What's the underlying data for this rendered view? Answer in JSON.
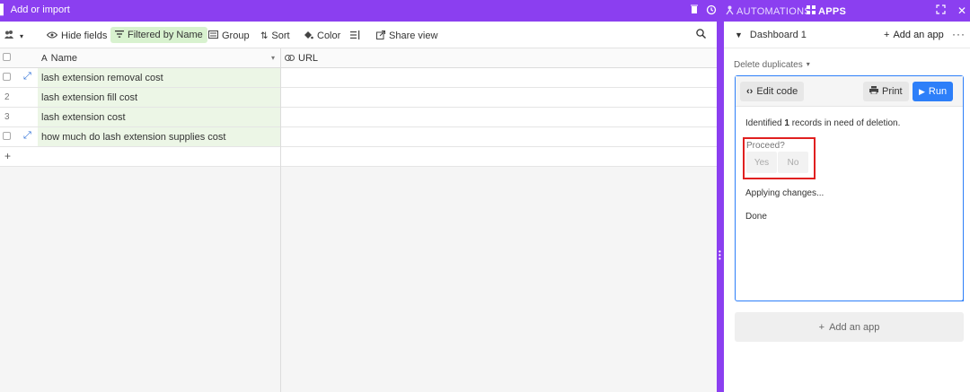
{
  "topbar": {
    "add_import": "Add or import",
    "automations": "AUTOMATIONS",
    "apps": "APPS",
    "icons": [
      "trash-icon",
      "history-icon",
      "people-icon",
      "apps-grid-icon",
      "expand-icon"
    ]
  },
  "toolbar": {
    "collaborators_icon": "collaborators-icon",
    "hide_fields": "Hide fields",
    "filtered_by": "Filtered by Name",
    "group": "Group",
    "sort": "Sort",
    "color": "Color",
    "share_view": "Share view"
  },
  "grid": {
    "columns": [
      {
        "name": "Name",
        "icon": "text-field-icon"
      },
      {
        "name": "URL",
        "icon": "link-icon"
      }
    ],
    "rows": [
      {
        "num": "",
        "name": "lash extension removal cost",
        "expanded": true
      },
      {
        "num": "2",
        "name": "lash extension fill cost",
        "expanded": false
      },
      {
        "num": "3",
        "name": "lash extension cost",
        "expanded": false
      },
      {
        "num": "",
        "name": "how much do lash extension supplies cost",
        "expanded": true
      }
    ],
    "add_row": "+"
  },
  "panel": {
    "dashboard_title": "Dashboard 1",
    "add_app": "Add an app",
    "app_name": "Delete duplicates",
    "app": {
      "edit_code": "Edit code",
      "print": "Print",
      "run": "Run",
      "msg_prefix": "Identified ",
      "msg_count": "1",
      "msg_suffix": " records in need of deletion.",
      "proceed_label": "Proceed?",
      "yes": "Yes",
      "no": "No",
      "applying": "Applying changes...",
      "done": "Done"
    },
    "add_app_bottom": "Add an app"
  },
  "colors": {
    "brand_purple": "#8b3ff0",
    "filter_green": "#d8f2cf",
    "run_blue": "#2d7ff9",
    "highlight_red": "#e02020"
  }
}
